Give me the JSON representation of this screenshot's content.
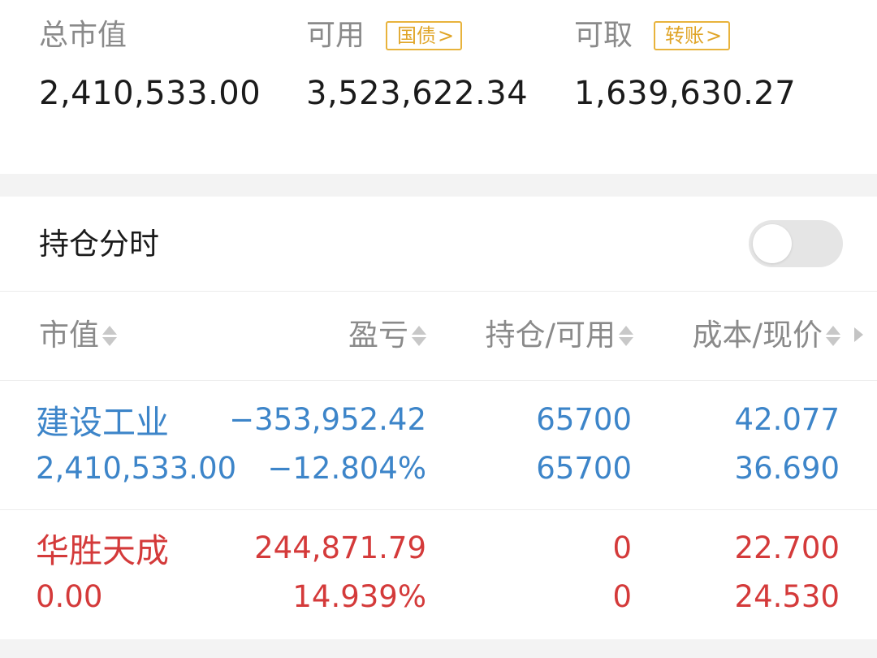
{
  "summary": {
    "total_market_value": {
      "label": "总市值",
      "value": "2,410,533.00"
    },
    "available": {
      "label": "可用",
      "tag": "国债",
      "value": "3,523,622.34"
    },
    "withdrawable": {
      "label": "可取",
      "tag": "转账",
      "value": "1,639,630.27"
    }
  },
  "position_timeshare": {
    "label": "持仓分时",
    "enabled": false
  },
  "table": {
    "headers": {
      "market_value": "市值",
      "pnl": "盈亏",
      "holding_available": "持仓/可用",
      "cost_price": "成本/现价"
    },
    "rows": [
      {
        "name": "建设工业",
        "market_value": "2,410,533.00",
        "pnl": "−353,952.42",
        "pnl_pct": "−12.804%",
        "holding": "65700",
        "available": "65700",
        "cost": "42.077",
        "price": "36.690",
        "color": "#3d85c9"
      },
      {
        "name": "华胜天成",
        "market_value": "0.00",
        "pnl": "244,871.79",
        "pnl_pct": "14.939%",
        "holding": "0",
        "available": "0",
        "cost": "22.700",
        "price": "24.530",
        "color": "#d43a3a"
      }
    ]
  },
  "colors": {
    "loss": "#3d85c9",
    "gain": "#d43a3a",
    "tag_accent": "#e8b33c",
    "section_gap": "#f3f3f3"
  }
}
